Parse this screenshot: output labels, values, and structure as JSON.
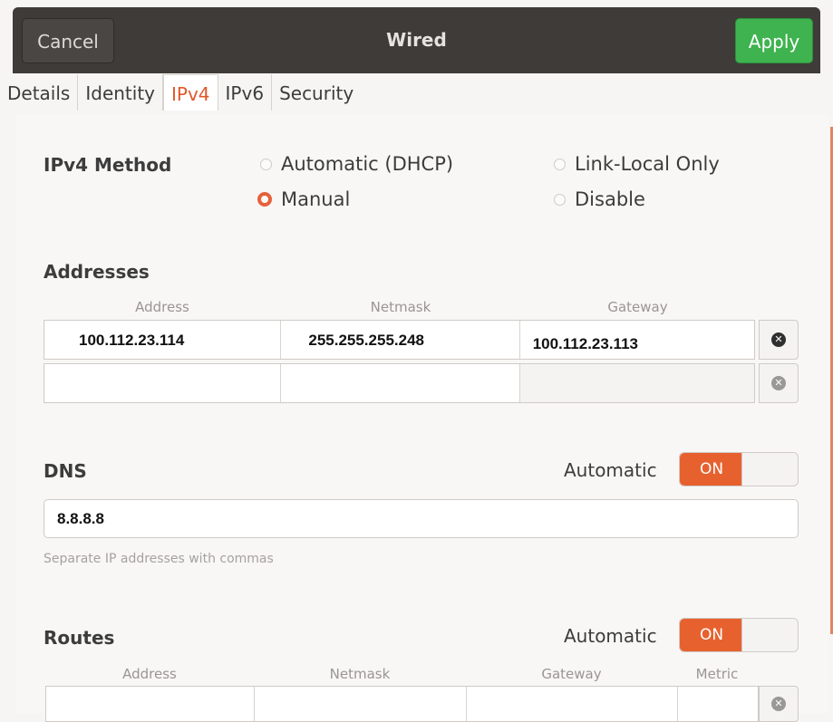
{
  "header": {
    "cancel_label": "Cancel",
    "title": "Wired",
    "apply_label": "Apply"
  },
  "tabs": [
    {
      "label": "Details"
    },
    {
      "label": "Identity"
    },
    {
      "label": "IPv4"
    },
    {
      "label": "IPv6"
    },
    {
      "label": "Security"
    }
  ],
  "active_tab": "IPv4",
  "ipv4": {
    "method_label": "IPv4 Method",
    "methods": [
      {
        "label": "Automatic (DHCP)",
        "selected": false
      },
      {
        "label": "Manual",
        "selected": true
      },
      {
        "label": "Link-Local Only",
        "selected": false
      },
      {
        "label": "Disable",
        "selected": false
      }
    ]
  },
  "addresses": {
    "label": "Addresses",
    "columns": [
      "Address",
      "Netmask",
      "Gateway"
    ],
    "rows": [
      {
        "address": "100.112.23.114",
        "netmask": "255.255.255.248",
        "gateway": "100.112.23.113"
      },
      {
        "address": "",
        "netmask": "",
        "gateway": ""
      }
    ]
  },
  "dns": {
    "label": "DNS",
    "automatic_label": "Automatic",
    "switch_state": "ON",
    "value": "8.8.8.8",
    "hint": "Separate IP addresses with commas"
  },
  "routes": {
    "label": "Routes",
    "automatic_label": "Automatic",
    "switch_state": "ON",
    "columns": [
      "Address",
      "Netmask",
      "Gateway",
      "Metric"
    ]
  },
  "colors": {
    "accent": "#e6613a",
    "apply": "#3eb34f",
    "titlebar": "#3f3b38"
  },
  "icons": {
    "delete": "close-circle-icon"
  }
}
